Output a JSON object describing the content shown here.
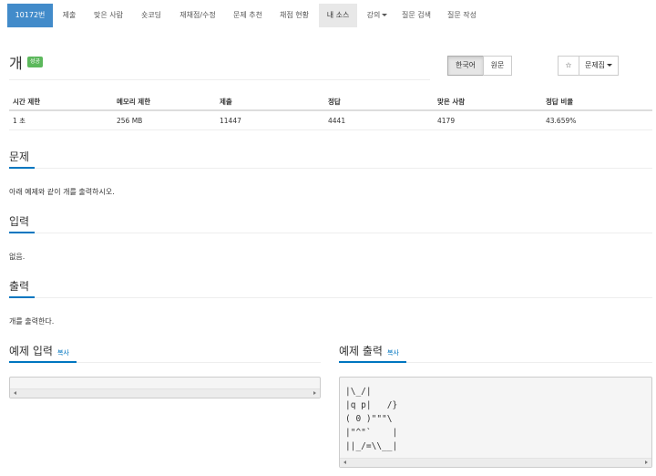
{
  "nav": {
    "tabs": [
      {
        "label": "10172번"
      },
      {
        "label": "제출"
      },
      {
        "label": "맞은 사람"
      },
      {
        "label": "숏코딩"
      },
      {
        "label": "재채점/수정"
      },
      {
        "label": "문제 추천"
      },
      {
        "label": "채점 현황"
      },
      {
        "label": "내 소스"
      },
      {
        "label": "강의"
      },
      {
        "label": "질문 검색"
      },
      {
        "label": "질문 작성"
      }
    ]
  },
  "problem": {
    "title": "개",
    "status_badge": "성공"
  },
  "controls": {
    "lang_korean": "한국어",
    "lang_original": "원문",
    "star": "☆",
    "problemset": "문제집"
  },
  "stats": {
    "headers": [
      "시간 제한",
      "메모리 제한",
      "제출",
      "정답",
      "맞은 사람",
      "정답 비율"
    ],
    "values": [
      "1 초",
      "256 MB",
      "11447",
      "4441",
      "4179",
      "43.659%"
    ]
  },
  "sections": {
    "description": {
      "heading": "문제",
      "text": "아래 예제와 같이 개를 출력하시오."
    },
    "input": {
      "heading": "입력",
      "text": "없음."
    },
    "output": {
      "heading": "출력",
      "text": "개를 출력한다."
    }
  },
  "samples": {
    "input": {
      "heading": "예제 입력",
      "copy": "복사",
      "content": ""
    },
    "output": {
      "heading": "예제 출력",
      "copy": "복사",
      "content": "|\\_/|\n|q p|   /}\n( 0 )\"\"\"\\\n|\"^\"`    |\n||_/=\\\\__|"
    }
  },
  "colors": {
    "primary": "#428bca",
    "accent": "#0076c0",
    "success": "#5cb85c"
  }
}
